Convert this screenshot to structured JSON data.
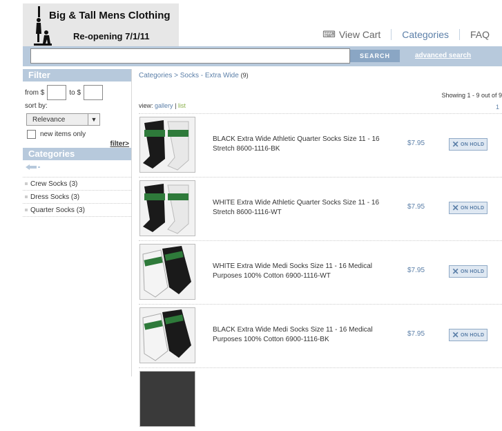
{
  "header": {
    "logo_title": "Big & Tall Mens Clothing",
    "logo_subtitle": "Re-opening 7/1/11",
    "nav": {
      "view_cart": "View Cart",
      "categories": "Categories",
      "faq": "FAQ"
    }
  },
  "search": {
    "value": "",
    "button": "SEARCH",
    "advanced": "advanced search"
  },
  "sidebar": {
    "filter_heading": "Filter",
    "from_label": "from $",
    "to_label": "to $",
    "sort_label": "sort by:",
    "sort_value": "Relevance",
    "new_only": "new items only",
    "filter_link": "filter>",
    "categories_heading": "Categories",
    "categories": [
      "Crew Socks (3)",
      "Dress Socks (3)",
      "Quarter Socks (3)"
    ]
  },
  "main": {
    "breadcrumb": {
      "root": "Categories",
      "separator": ">",
      "current": "Socks - Extra Wide",
      "count": "(9)"
    },
    "showing": "Showing 1 - 9 out of 9",
    "page": "1",
    "view_label": "view:",
    "view_gallery": "gallery",
    "view_divider": "|",
    "view_list": "list",
    "products": [
      {
        "name": "BLACK Extra Wide Athletic Quarter Socks Size 11 - 16 Stretch 8600-1116-BK",
        "price": "$7.95",
        "status": "ON HOLD"
      },
      {
        "name": "WHITE Extra Wide Athletic Quarter Socks Size 11 - 16 Stretch 8600-1116-WT",
        "price": "$7.95",
        "status": "ON HOLD"
      },
      {
        "name": "WHITE Extra Wide Medi Socks Size 11 - 16 Medical Purposes 100% Cotton 6900-1116-WT",
        "price": "$7.95",
        "status": "ON HOLD"
      },
      {
        "name": "BLACK Extra Wide Medi Socks Size 11 - 16 Medical Purposes 100% Cotton 6900-1116-BK",
        "price": "$7.95",
        "status": "ON HOLD"
      }
    ]
  },
  "colors": {
    "accent": "#b7c9dc",
    "link": "#5b7fa8",
    "list_link": "#8ab04a"
  }
}
